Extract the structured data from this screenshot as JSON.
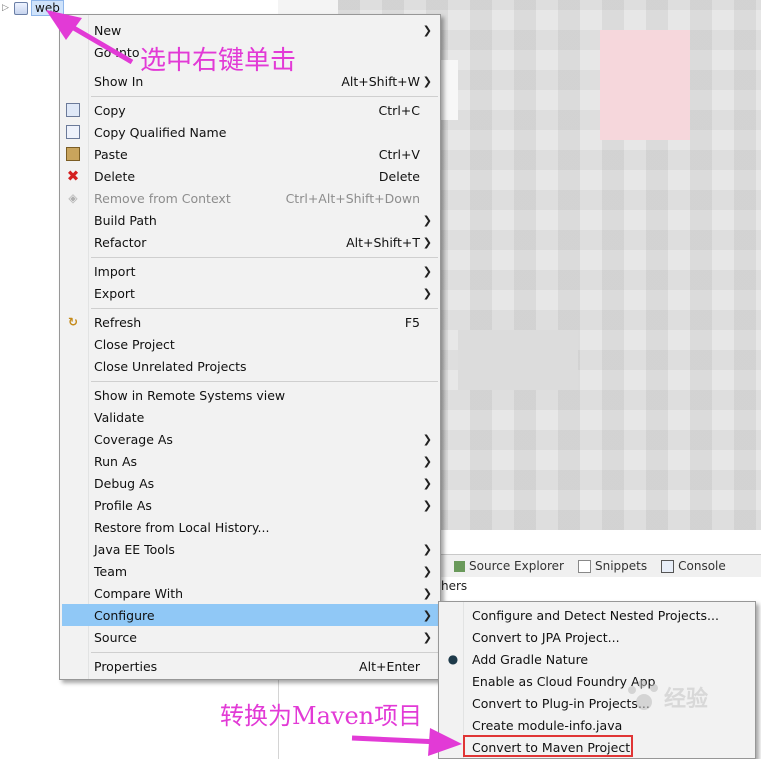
{
  "project_tree": {
    "item_label": "web"
  },
  "context_menu": {
    "items": [
      {
        "label": "New",
        "accel": "",
        "submenu": true
      },
      {
        "label": "Go Into",
        "accel": "",
        "submenu": false
      },
      {
        "label": "Show In",
        "accel": "Alt+Shift+W",
        "submenu": true
      },
      {
        "label": "Copy",
        "accel": "Ctrl+C",
        "icon": "copy-icon"
      },
      {
        "label": "Copy Qualified Name",
        "accel": "",
        "icon": "copy-qualified-icon"
      },
      {
        "label": "Paste",
        "accel": "Ctrl+V",
        "icon": "paste-icon"
      },
      {
        "label": "Delete",
        "accel": "Delete",
        "icon": "delete-icon"
      },
      {
        "label": "Remove from Context",
        "accel": "Ctrl+Alt+Shift+Down",
        "icon": "remove-context-icon",
        "disabled": true
      },
      {
        "label": "Build Path",
        "accel": "",
        "submenu": true
      },
      {
        "label": "Refactor",
        "accel": "Alt+Shift+T",
        "submenu": true
      },
      {
        "label": "Import",
        "accel": "",
        "submenu": true
      },
      {
        "label": "Export",
        "accel": "",
        "submenu": true
      },
      {
        "label": "Refresh",
        "accel": "F5",
        "icon": "refresh-icon"
      },
      {
        "label": "Close Project",
        "accel": ""
      },
      {
        "label": "Close Unrelated Projects",
        "accel": ""
      },
      {
        "label": "Show in Remote Systems view",
        "accel": ""
      },
      {
        "label": "Validate",
        "accel": ""
      },
      {
        "label": "Coverage As",
        "accel": "",
        "submenu": true
      },
      {
        "label": "Run As",
        "accel": "",
        "submenu": true
      },
      {
        "label": "Debug As",
        "accel": "",
        "submenu": true
      },
      {
        "label": "Profile As",
        "accel": "",
        "submenu": true
      },
      {
        "label": "Restore from Local History...",
        "accel": ""
      },
      {
        "label": "Java EE Tools",
        "accel": "",
        "submenu": true
      },
      {
        "label": "Team",
        "accel": "",
        "submenu": true
      },
      {
        "label": "Compare With",
        "accel": "",
        "submenu": true
      },
      {
        "label": "Configure",
        "accel": "",
        "submenu": true,
        "highlighted": true
      },
      {
        "label": "Source",
        "accel": "",
        "submenu": true
      },
      {
        "label": "Properties",
        "accel": "Alt+Enter"
      }
    ]
  },
  "configure_submenu": {
    "items": [
      {
        "label": "Configure and Detect Nested Projects..."
      },
      {
        "label": "Convert to JPA Project..."
      },
      {
        "label": "Add Gradle Nature",
        "icon": "gradle-elephant-icon"
      },
      {
        "label": "Enable as Cloud Foundry App"
      },
      {
        "label": "Convert to Plug-in Projects..."
      },
      {
        "label": "Create module-info.java"
      },
      {
        "label": "Convert to Maven Project",
        "boxed": true
      }
    ]
  },
  "bottom_tabs": {
    "tabs": [
      {
        "label": "Data Source Explorer",
        "visible_label": "Source Explorer"
      },
      {
        "label": "Snippets"
      },
      {
        "label": "Console"
      }
    ],
    "console_text": "hers"
  },
  "annotations": {
    "right_click_hint": "选中右键单击",
    "convert_hint": "转换为Maven项目",
    "color": "#e23ad6"
  },
  "watermark": {
    "text": "经验"
  },
  "colors": {
    "menu_bg": "#f2f2f2",
    "highlight": "#90c8f6",
    "box_red": "#e03535",
    "annotation_pink": "#e23ad6"
  }
}
